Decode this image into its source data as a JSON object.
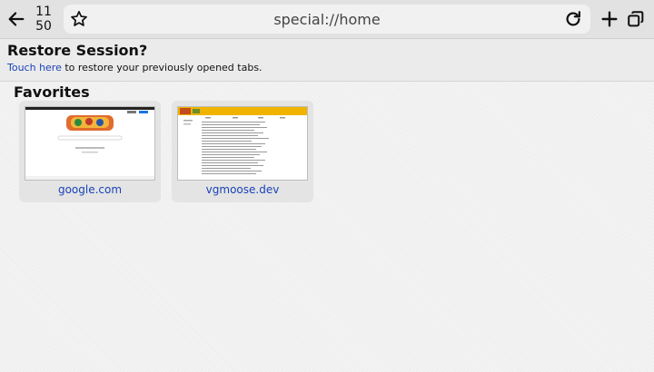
{
  "toolbar": {
    "clock_hour": "11",
    "clock_minute": "50",
    "address": "special://home",
    "icons": [
      "back-arrow-icon",
      "star-icon",
      "reload-icon",
      "plus-icon",
      "tabs-icon"
    ]
  },
  "restore": {
    "title": "Restore Session?",
    "link_text": "Touch here",
    "rest_text": " to restore your previously opened tabs."
  },
  "favorites": {
    "heading": "Favorites",
    "items": [
      {
        "label": "google.com"
      },
      {
        "label": "vgmoose.dev"
      }
    ]
  },
  "colors": {
    "link": "#1a43b8",
    "toolbar_bg": "#e2e2e2",
    "address_bg": "#f1f1f1"
  }
}
